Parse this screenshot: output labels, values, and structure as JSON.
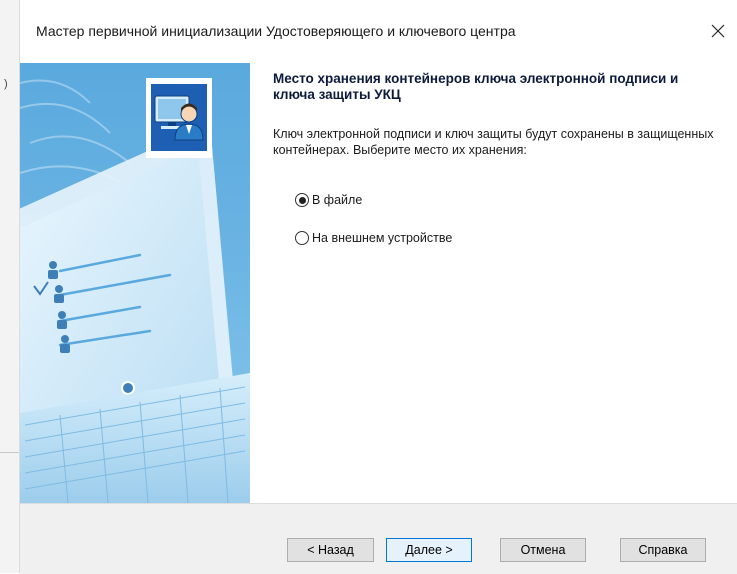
{
  "window": {
    "title": "Мастер первичной инициализации Удостоверяющего и ключевого центра",
    "close_glyph": "✕",
    "edge_mark": ")"
  },
  "content": {
    "heading": "Место хранения контейнеров ключа электронной подписи и ключа защиты УКЦ",
    "description": "Ключ электронной подписи и ключ защиты будут сохранены в защищенных контейнерах. Выберите место их хранения:",
    "options": [
      {
        "label": "В файле",
        "selected": true
      },
      {
        "label": "На внешнем устройстве",
        "selected": false
      }
    ]
  },
  "buttons": {
    "back": "< Назад",
    "next": "Далее >",
    "cancel": "Отмена",
    "help": "Справка"
  },
  "icons": {
    "close": "close-icon",
    "user_computer": "user-computer-icon",
    "illustration": "computer-monitor-illustration"
  },
  "colors": {
    "illustration_blue": "#5aa9de",
    "default_button_border": "#0078d7",
    "footer_bg": "#f0f0f0"
  }
}
